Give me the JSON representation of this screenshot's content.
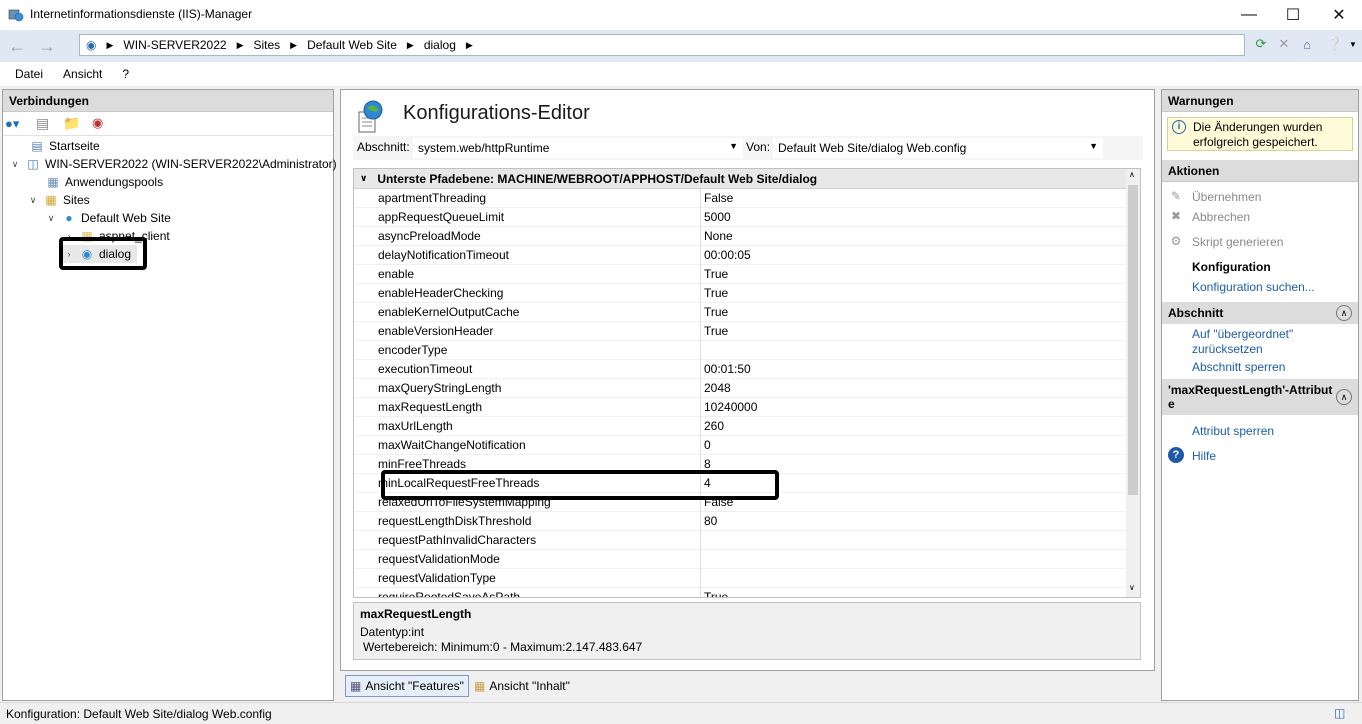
{
  "window": {
    "title": "Internetinformationsdienste (IIS)-Manager"
  },
  "address": {
    "crumbs": [
      "WIN-SERVER2022",
      "Sites",
      "Default Web Site",
      "dialog"
    ]
  },
  "menu": {
    "items": [
      "Datei",
      "Ansicht",
      "?"
    ]
  },
  "connections": {
    "header": "Verbindungen",
    "tree": [
      {
        "label": "Startseite"
      },
      {
        "label": "WIN-SERVER2022 (WIN-SERVER2022\\Administrator)"
      },
      {
        "label": "Anwendungspools"
      },
      {
        "label": "Sites"
      },
      {
        "label": "Default Web Site"
      },
      {
        "label": "aspnet_client"
      },
      {
        "label": "dialog"
      }
    ]
  },
  "editor": {
    "title": "Konfigurations-Editor",
    "section_label": "Abschnitt:",
    "section_value": "system.web/httpRuntime",
    "from_label": "Von:",
    "from_value": "Default Web Site/dialog Web.config",
    "grid_header": "Unterste Pfadebene: MACHINE/WEBROOT/APPHOST/Default Web Site/dialog",
    "rows": [
      {
        "name": "apartmentThreading",
        "value": "False"
      },
      {
        "name": "appRequestQueueLimit",
        "value": "5000"
      },
      {
        "name": "asyncPreloadMode",
        "value": "None"
      },
      {
        "name": "delayNotificationTimeout",
        "value": "00:00:05"
      },
      {
        "name": "enable",
        "value": "True"
      },
      {
        "name": "enableHeaderChecking",
        "value": "True"
      },
      {
        "name": "enableKernelOutputCache",
        "value": "True"
      },
      {
        "name": "enableVersionHeader",
        "value": "True"
      },
      {
        "name": "encoderType",
        "value": ""
      },
      {
        "name": "executionTimeout",
        "value": "00:01:50"
      },
      {
        "name": "maxQueryStringLength",
        "value": "2048"
      },
      {
        "name": "maxRequestLength",
        "value": "10240000"
      },
      {
        "name": "maxUrlLength",
        "value": "260"
      },
      {
        "name": "maxWaitChangeNotification",
        "value": "0"
      },
      {
        "name": "minFreeThreads",
        "value": "8"
      },
      {
        "name": "minLocalRequestFreeThreads",
        "value": "4"
      },
      {
        "name": "relaxedUrlToFileSystemMapping",
        "value": "False"
      },
      {
        "name": "requestLengthDiskThreshold",
        "value": "80"
      },
      {
        "name": "requestPathInvalidCharacters",
        "value": ""
      },
      {
        "name": "requestValidationMode",
        "value": ""
      },
      {
        "name": "requestValidationType",
        "value": ""
      },
      {
        "name": "requireRootedSaveAsPath",
        "value": "True"
      }
    ],
    "detail_name": "maxRequestLength",
    "detail_type": "Datentyp:int",
    "detail_range": "Wertebereich: Minimum:0 - Maximum:2.147.483.647"
  },
  "view_tabs": {
    "features": "Ansicht \"Features\"",
    "content": "Ansicht \"Inhalt\""
  },
  "right": {
    "warnings_header": "Warnungen",
    "warning_text": "Die Änderungen wurden erfolgreich gespeichert.",
    "actions_header": "Aktionen",
    "apply": "Übernehmen",
    "cancel": "Abbrechen",
    "script": "Skript generieren",
    "config_header": "Konfiguration",
    "config_search": "Konfiguration suchen...",
    "section_header": "Abschnitt",
    "section_reset": "Auf \"übergeordnet\" zurücksetzen",
    "section_lock": "Abschnitt sperren",
    "attr_header": "'maxRequestLength'-Attribute",
    "attr_lock": "Attribut sperren",
    "help": "Hilfe"
  },
  "status": {
    "text": "Konfiguration: Default Web Site/dialog Web.config"
  }
}
